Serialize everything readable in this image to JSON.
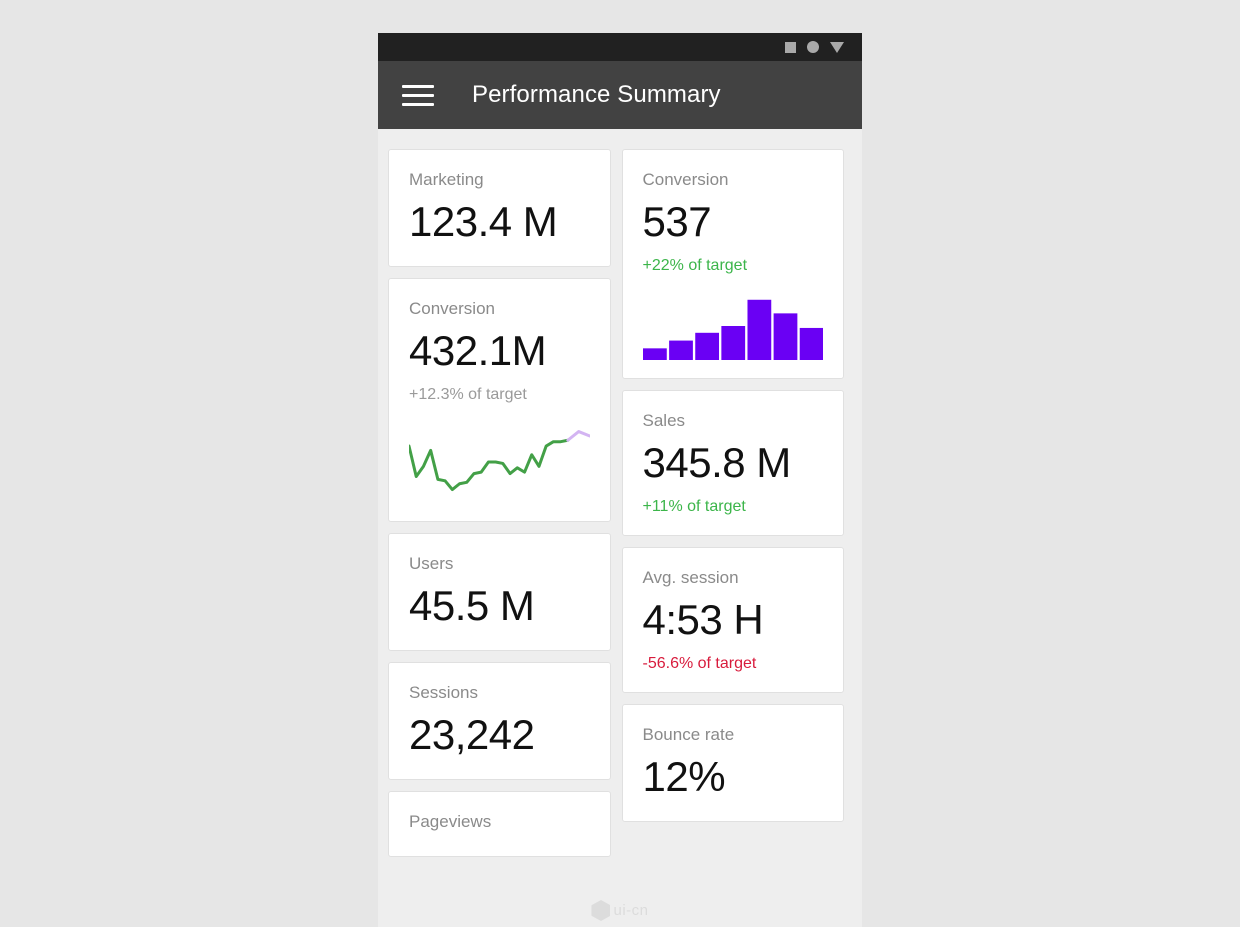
{
  "statusbar": {
    "icons": [
      {
        "name": "square-icon",
        "glyph": "square"
      },
      {
        "name": "circle-icon",
        "glyph": "circle"
      },
      {
        "name": "triangle-down-icon",
        "glyph": "triangle-down"
      }
    ]
  },
  "toolbar": {
    "menu_icon": "hamburger-menu-icon",
    "title": "Performance Summary"
  },
  "colors": {
    "status_bar": "#212121",
    "toolbar": "#424242",
    "page_background": "#e6e6e6",
    "app_background": "#eeeeee",
    "card_background": "#ffffff",
    "card_border": "#e0e0e0",
    "title_text": "#8a8a8a",
    "value_text": "#111111",
    "positive": "#3cb54a",
    "negative": "#d81b3c",
    "neutral": "#9a9a9a",
    "bar_chart": "#6a00f4",
    "sparkline": "#43a047",
    "sparkline_forecast": "#d3b4f2"
  },
  "watermark": {
    "text": "ui-cn"
  },
  "left_column": {
    "cards": [
      {
        "title": "Marketing",
        "value": "123.4 M",
        "delta": null,
        "delta_tone": null
      },
      {
        "title": "Conversion",
        "value": "432.1M",
        "delta": "+12.3% of target",
        "delta_tone": "neutral"
      },
      {
        "title": "Users",
        "value": "45.5 M",
        "delta": null,
        "delta_tone": null
      },
      {
        "title": "Sessions",
        "value": "23,242",
        "delta": null,
        "delta_tone": null
      },
      {
        "title": "Pageviews",
        "value": "",
        "delta": null,
        "delta_tone": null
      }
    ]
  },
  "right_column": {
    "cards": [
      {
        "title": "Conversion",
        "value": "537",
        "delta": "+22% of target",
        "delta_tone": "positive"
      },
      {
        "title": "Sales",
        "value": "345.8 M",
        "delta": "+11% of target",
        "delta_tone": "positive"
      },
      {
        "title": "Avg. session",
        "value": "4:53 H",
        "delta": "-56.6% of target",
        "delta_tone": "negative"
      },
      {
        "title": "Bounce rate",
        "value": "12%",
        "delta": null,
        "delta_tone": null
      }
    ]
  },
  "chart_data": [
    {
      "id": "conversion-bar-chart",
      "type": "bar",
      "title": "Conversion",
      "xlabel": "",
      "ylabel": "",
      "categories": [
        "1",
        "2",
        "3",
        "4",
        "5",
        "6",
        "7"
      ],
      "values": [
        12,
        20,
        28,
        35,
        62,
        48,
        33
      ],
      "ylim": [
        0,
        70
      ],
      "grid": false,
      "legend": "none",
      "color": "#6a00f4"
    },
    {
      "id": "conversion-sparkline",
      "type": "line",
      "title": "Conversion",
      "xlabel": "",
      "ylabel": "",
      "grid": false,
      "legend": "none",
      "ylim": [
        0,
        100
      ],
      "series": [
        {
          "name": "actual",
          "color": "#43a047",
          "x": [
            0,
            4,
            8,
            12,
            16,
            20,
            24,
            28,
            32,
            36,
            40,
            44,
            48,
            52,
            56,
            60,
            64,
            68,
            72,
            76,
            80,
            84,
            88
          ],
          "values": [
            72,
            30,
            44,
            66,
            26,
            24,
            12,
            20,
            22,
            34,
            36,
            50,
            50,
            48,
            34,
            42,
            36,
            60,
            44,
            72,
            78,
            78,
            80
          ]
        },
        {
          "name": "forecast",
          "color": "#d3b4f2",
          "x": [
            88,
            94,
            100
          ],
          "values": [
            80,
            92,
            86
          ]
        }
      ]
    }
  ]
}
